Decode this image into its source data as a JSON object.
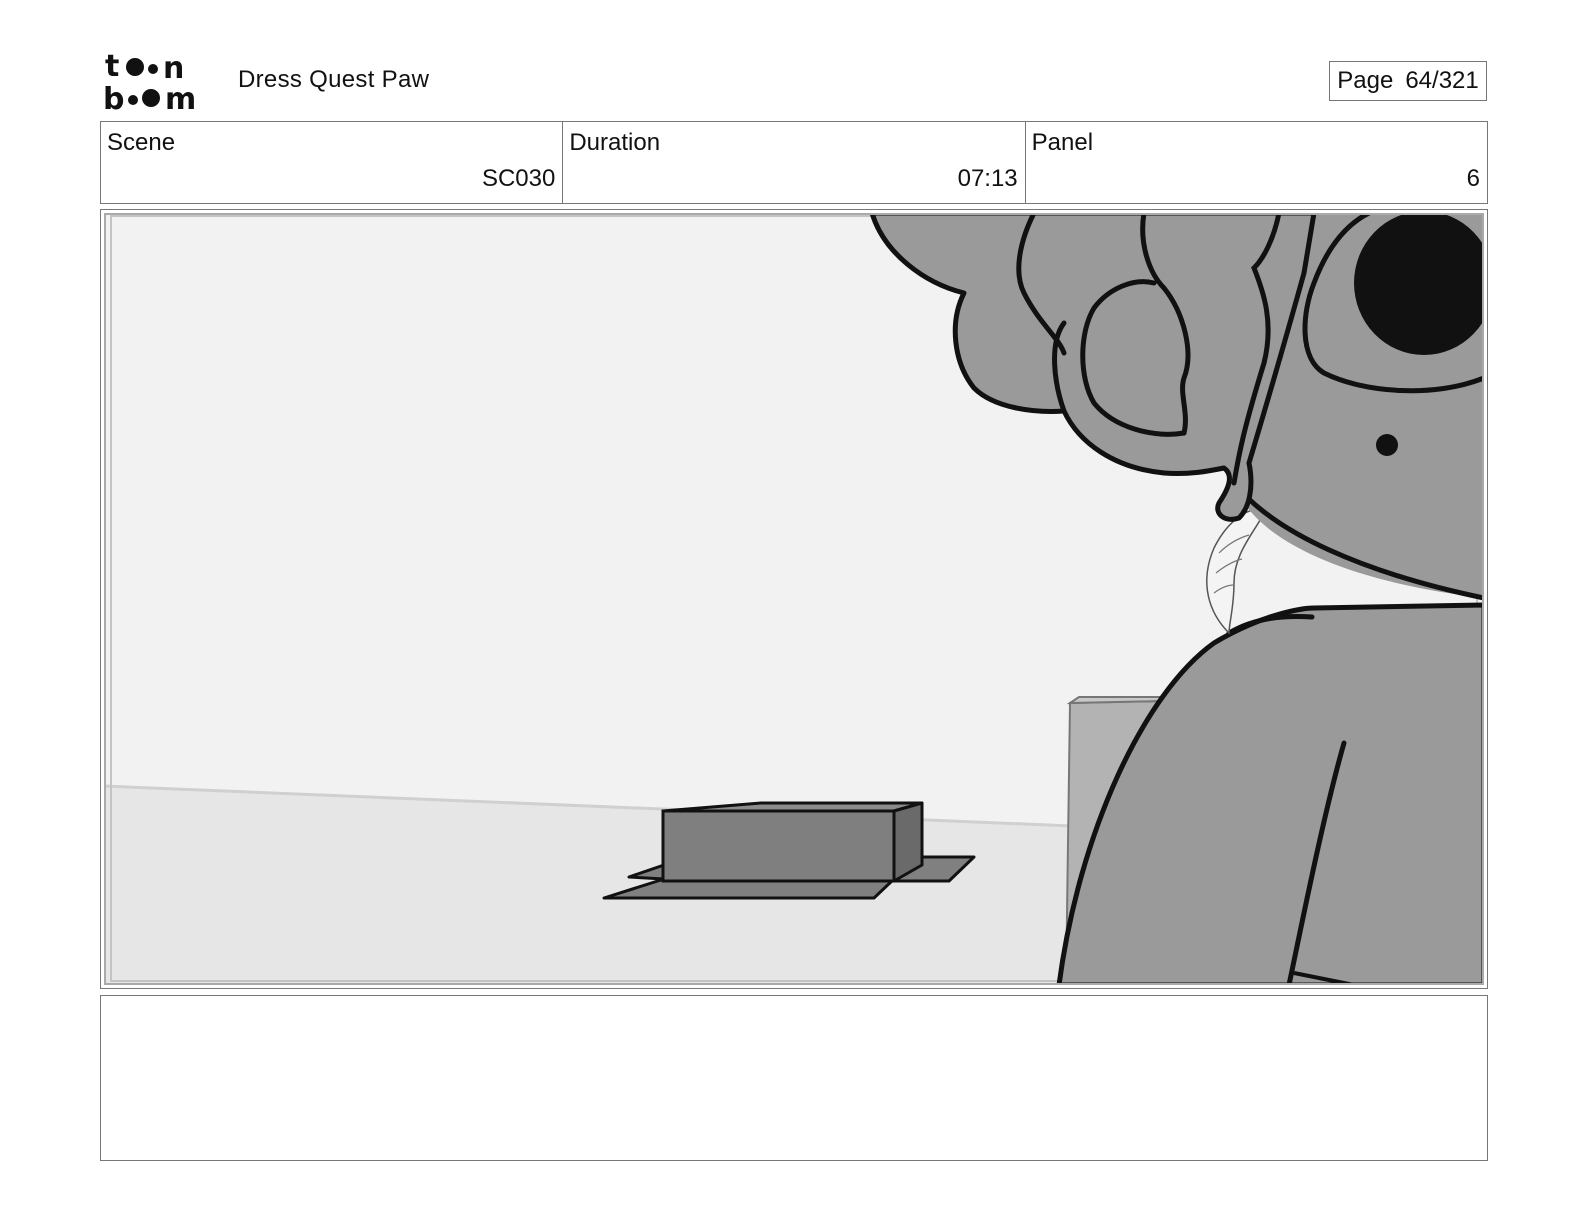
{
  "header": {
    "logo_alt": "toon boom",
    "project_title": "Dress Quest Paw",
    "page_label": "Page",
    "page_number": "64/321"
  },
  "info": {
    "scene_label": "Scene",
    "scene_value": "SC030",
    "duration_label": "Duration",
    "duration_value": "07:13",
    "panel_label": "Panel",
    "panel_value": "6"
  },
  "panel_image": {
    "icon": "storyboard-drawing",
    "palette": {
      "sky": "#f2f2f2",
      "floor": "#e6e6e6",
      "character": "#9a9a9a",
      "box": "#808080"
    }
  },
  "notes": {
    "text": ""
  }
}
